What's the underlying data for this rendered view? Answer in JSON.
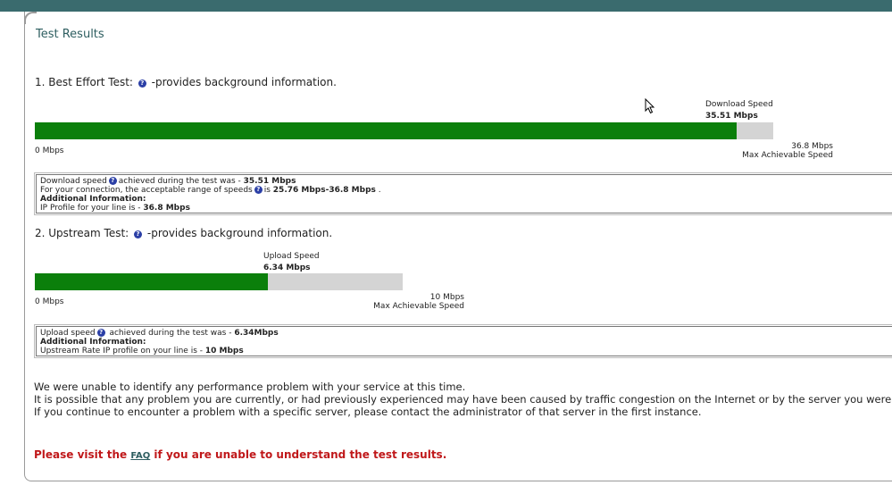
{
  "title": "Test Results",
  "best_effort": {
    "heading_prefix": "1. Best Effort Test:",
    "heading_suffix": "-provides background information.",
    "speed_label": "Download Speed",
    "speed_value": "35.51 Mbps",
    "min_label": "0 Mbps",
    "max_value": "36.8 Mbps",
    "max_label": "Max Achievable Speed",
    "bar_fraction": 0.9503,
    "info": {
      "line1_prefix": "Download speed",
      "line1_mid": "achieved during the test was - ",
      "line1_value": "35.51 Mbps",
      "line2_prefix": "For your connection, the acceptable range of speeds",
      "line2_mid": "is ",
      "line2_value": "25.76 Mbps-36.8 Mbps",
      "line2_end": " .",
      "line3": "Additional Information:",
      "line4_prefix": "IP Profile for your line is - ",
      "line4_value": "36.8 Mbps"
    }
  },
  "upstream": {
    "heading_prefix": "2. Upstream Test:",
    "heading_suffix": "-provides background information.",
    "speed_label": "Upload Speed",
    "speed_value": "6.34 Mbps",
    "min_label": "0 Mbps",
    "max_value": "10 Mbps",
    "max_label": "Max Achievable Speed",
    "bar_fraction": 0.634,
    "info": {
      "line1_prefix": "Upload speed",
      "line1_mid": " achieved during the test was - ",
      "line1_value": "6.34Mbps",
      "line2": "Additional Information:",
      "line3_prefix": "Upstream Rate IP profile on your line is - ",
      "line3_value": "10 Mbps"
    }
  },
  "summary": {
    "line1": "We were unable to identify any performance problem with your service at this time.",
    "line2": "It is possible that any problem you are currently, or had previously experienced may have been caused by traffic congestion on the Internet or by the server you were ac",
    "line3": "If you continue to encounter a problem with a specific server, please contact the administrator of that server in the first instance."
  },
  "faq": {
    "prefix": "Please visit the ",
    "link": "FAQ",
    "suffix": " if you are unable to understand the test results."
  },
  "colors": {
    "header": "#3a6b6e",
    "bar_fill": "#0b7f0b",
    "bar_track": "#d4d4d4",
    "faq_text": "#c0181a"
  },
  "icons": {
    "help": "question-circle-icon",
    "cursor": "mouse-pointer-icon"
  }
}
